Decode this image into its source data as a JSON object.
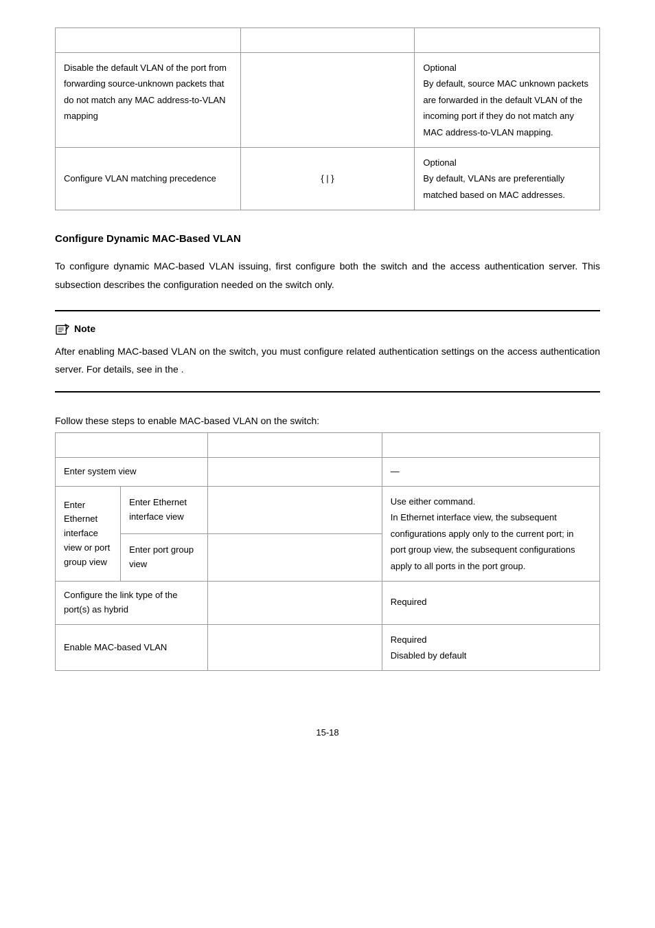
{
  "table1": {
    "rows": [
      {
        "toDo": "Disable the default VLAN of the port from forwarding source-unknown packets that do not match any MAC address-to-VLAN mapping",
        "cmd": "",
        "remarks": "Optional\nBy default, source MAC unknown packets are forwarded in the default VLAN of the incoming port if they do not match any MAC address-to-VLAN mapping."
      },
      {
        "toDo": "Configure VLAN matching precedence",
        "cmd": "{ | }",
        "remarks": "Optional\nBy default, VLANs are preferentially matched based on MAC addresses."
      }
    ]
  },
  "sectionTitle": "Configure Dynamic MAC-Based VLAN",
  "introText": "To configure dynamic MAC-based VLAN issuing, first configure both the switch and the access authentication server. This subsection describes the configuration needed on the switch only.",
  "note": {
    "label": "Note",
    "textPart1": "After enabling MAC-based VLAN on the switch, you must configure related authentication settings on the access authentication server. For details, see ",
    "textItalic1": "",
    "textPart2": " in the ",
    "textItalic2": "",
    "textPart3": "."
  },
  "followText": "Follow these steps to enable MAC-based VLAN on the switch:",
  "table2": {
    "rows": {
      "enterSystem": "Enter system view",
      "enterSystemDash": "—",
      "enterEthGroup": "Enter Ethernet interface view or port group view",
      "enterEthView": "Enter Ethernet interface view",
      "enterPortGroup": "Enter port group view",
      "ethDesc": "Use either command.\nIn Ethernet interface view, the subsequent configurations apply only to the current port; in port group view, the subsequent configurations apply to all ports in the port group.",
      "configLink": "Configure the link type of the port(s) as hybrid",
      "configLinkRemark": "Required",
      "enableMac": "Enable MAC-based VLAN",
      "enableMacRemark": "Required\nDisabled by default"
    }
  },
  "pageNum": "15-18"
}
